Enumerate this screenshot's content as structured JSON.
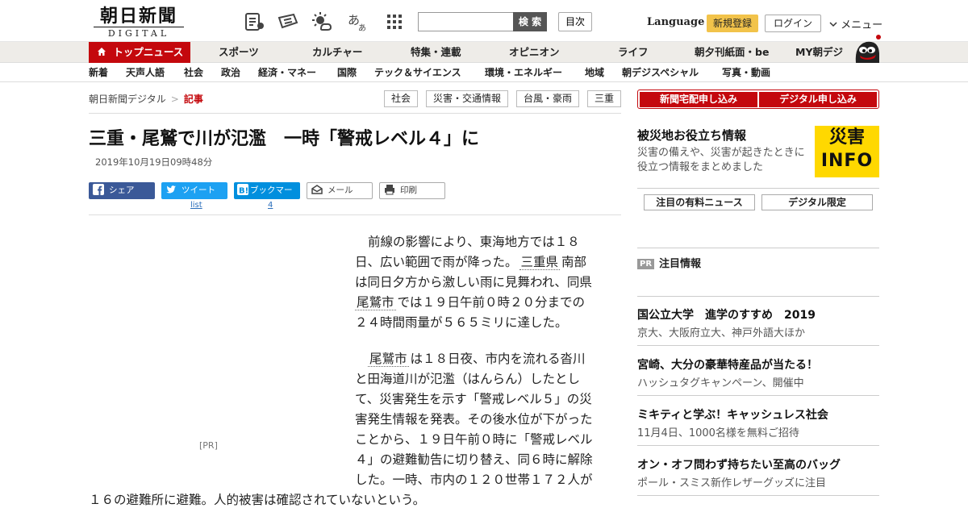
{
  "header": {
    "logo_main": "朝日新聞",
    "logo_sub": "DIGITAL",
    "search_button": "検 索",
    "toc_button": "目次",
    "language": "Language",
    "signup": "新規登録",
    "login": "ログイン",
    "menu": "メニュー"
  },
  "main_nav": {
    "top": "トップニュース",
    "items": [
      "スポーツ",
      "カルチャー",
      "特集・連載",
      "オピニオン",
      "ライフ",
      "朝夕刊紙面・be",
      "MY朝デジ"
    ]
  },
  "sub_nav": {
    "items": [
      "新着",
      "天声人語",
      "社会",
      "政治",
      "経済・マネー",
      "国際",
      "テック＆サイエンス",
      "環境・エネルギー",
      "地域",
      "朝デジスペシャル",
      "写真・動画"
    ]
  },
  "breadcrumb": {
    "home": "朝日新聞デジタル",
    "separator": ">",
    "current": "記事"
  },
  "tags": [
    "社会",
    "災害・交通情報",
    "台風・豪雨",
    "三重"
  ],
  "article": {
    "title": "三重・尾鷲で川が氾濫　一時「警戒レベル４」に",
    "date": "2019年10月19日09時48分",
    "share": {
      "facebook": "シェア",
      "twitter": "ツイート",
      "twitter_count": "list",
      "hatena": "ブックマーク",
      "hatena_count": "4",
      "mail": "メール",
      "print": "印刷"
    },
    "pr_label": "[PR]",
    "p1": {
      "l1": "前線の影響により、東海地方では１８",
      "l2": "日、広い範囲で雨が降った。",
      "l2_link": "三重県",
      "l2_tail": "南部",
      "l3": "は同日夕方から激しい雨に見舞われ、同県",
      "l4_link": "尾鷲市",
      "l4_tail": "では１９日午前０時２０分までの",
      "l5": "２４時間雨量が５６５ミリに達した。"
    },
    "p2": {
      "l1_link": "尾鷲市",
      "l1_tail": "は１８日夜、市内を流れる沓川",
      "l2": "と田海道川が氾濫（はんらん）したとし",
      "l3": "て、災害発生を示す「警戒レベル５」の災",
      "l4": "害発生情報を発表。その後水位が下がった",
      "l5": "ことから、１９日午前０時に「警戒レベル",
      "l6": "４」の避難勧告に切り替え、同６時に解除",
      "l7": "した。一時、市内の１２０世帯１７２人が",
      "l8": "１６の避難所に避難。人的被害は確認されていないという。"
    }
  },
  "sidebar": {
    "subscribe_paper": "新聞宅配申し込み",
    "subscribe_digital": "デジタル申し込み",
    "disaster_title": "被災地お役立ち情報",
    "disaster_desc": "災害の備えや、災害が起きたときに役立つ情報をまとめました",
    "info_logo_top": "災害",
    "info_logo_bottom": "INFO",
    "paid_news": "注目の有料ニュース",
    "digital_only": "デジタル限定",
    "pr_badge": "PR",
    "pr_heading": "注目情報",
    "pr_items": [
      {
        "title": "国公立大学　進学のすすめ　2019",
        "sub": "京大、大阪府立大、神戸外語大ほか"
      },
      {
        "title": "宮崎、大分の豪華特産品が当たる！",
        "sub": "ハッシュタグキャンペーン、開催中"
      },
      {
        "title": "ミキティと学ぶ！キャッシュレス社会",
        "sub": "11月4日、1000名様を無料ご招待"
      },
      {
        "title": "オン・オフ問わず持ちたい至高のバッグ",
        "sub": "ポール・スミス新作レザーグッズに注目"
      }
    ]
  },
  "colors": {
    "brand_red": "#c4080d",
    "signup_yellow": "#f2c34a",
    "facebook_blue": "#3b5998",
    "twitter_blue": "#1da1f2",
    "hatena_blue": "#008fde",
    "info_yellow": "#ffd800"
  },
  "icons": [
    "list-icon",
    "newspaper-icon",
    "weather-icon",
    "font-size-icon",
    "apps-grid-icon",
    "home-icon",
    "facebook-icon",
    "twitter-icon",
    "hatena-icon",
    "mail-icon",
    "print-icon",
    "chevron-down-icon",
    "mascot-icon"
  ]
}
